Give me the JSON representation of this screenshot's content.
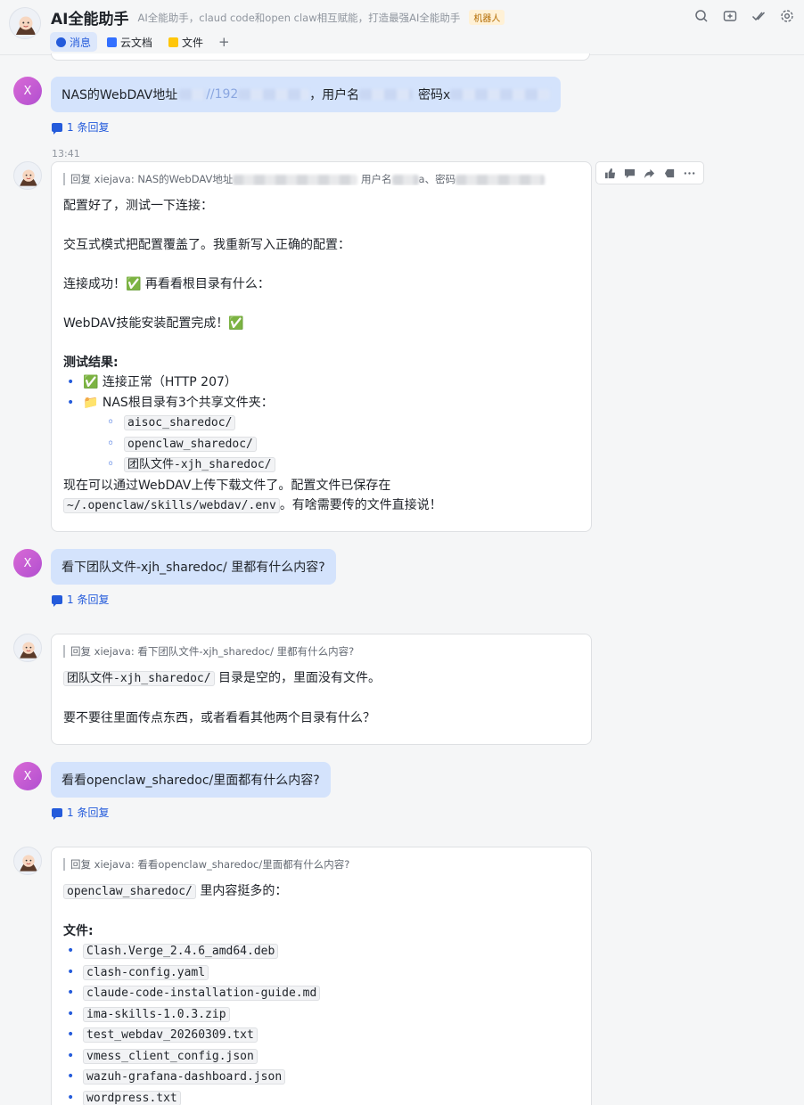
{
  "header": {
    "title": "AI全能助手",
    "description": "AI全能助手，claud code和open claw相互赋能，打造最强AI全能助手",
    "badge": "机器人",
    "tabs": [
      {
        "label": "消息",
        "icon": "chat-icon",
        "active": true
      },
      {
        "label": "云文档",
        "icon": "doc-icon",
        "active": false
      },
      {
        "label": "文件",
        "icon": "folder-icon",
        "active": false
      }
    ],
    "add_tab": "+",
    "icons": [
      "search-icon",
      "new-group-icon",
      "check-mark-icon",
      "settings-icon"
    ]
  },
  "messages": [
    {
      "type": "user",
      "avatar_initial": "X",
      "text_prefix": "NAS的WebDAV地址",
      "text_mid1": "//192",
      "text_mid2": "，用户名",
      "text_mid3": "密码x",
      "reply_count": "1 条回复"
    },
    {
      "type": "bot",
      "time": "13:41",
      "quote_prefix": "回复 xiejava:",
      "quote_text_a": "NAS的WebDAV地址",
      "quote_text_b": "用户名",
      "quote_text_c": "a、密码",
      "lines": [
        "配置好了，测试一下连接：",
        "交互式模式把配置覆盖了。我重新写入正确的配置：",
        "连接成功！✅ 再看看根目录有什么：",
        "WebDAV技能安装配置完成！✅"
      ],
      "result_heading": "测试结果:",
      "result_items": [
        "✅ 连接正常（HTTP 207）",
        "📁 NAS根目录有3个共享文件夹："
      ],
      "folders": [
        "aisoc_sharedoc/",
        "openclaw_sharedoc/",
        "团队文件-xjh_sharedoc/"
      ],
      "footer_a": "现在可以通过WebDAV上传下载文件了。配置文件已保存在",
      "footer_code": "~/.openclaw/skills/webdav/.env",
      "footer_b": "。有啥需要传的文件直接说！"
    },
    {
      "type": "user",
      "avatar_initial": "X",
      "text": "看下团队文件-xjh_sharedoc/ 里都有什么内容?",
      "reply_count": "1 条回复"
    },
    {
      "type": "bot",
      "quote_prefix": "回复 xiejava:",
      "quote_text": "看下团队文件-xjh_sharedoc/ 里都有什么内容?",
      "code": "团队文件-xjh_sharedoc/",
      "line1": " 目录是空的，里面没有文件。",
      "line2": "要不要往里面传点东西，或者看看其他两个目录有什么？"
    },
    {
      "type": "user",
      "avatar_initial": "X",
      "text": "看看openclaw_sharedoc/里面都有什么内容?",
      "reply_count": "1 条回复"
    },
    {
      "type": "bot",
      "quote_prefix": "回复 xiejava:",
      "quote_text": "看看openclaw_sharedoc/里面都有什么内容?",
      "code": "openclaw_sharedoc/",
      "line1": " 里内容挺多的：",
      "files_heading": "文件:",
      "files": [
        "Clash.Verge_2.4.6_amd64.deb",
        "clash-config.yaml",
        "claude-code-installation-guide.md",
        "ima-skills-1.0.3.zip",
        "test_webdav_20260309.txt",
        "vmess_client_config.json",
        "wazuh-grafana-dashboard.json",
        "wordpress.txt"
      ]
    }
  ],
  "toolbar": [
    "thumbs-up-icon",
    "comment-icon",
    "forward-icon",
    "pin-icon",
    "more-icon"
  ]
}
